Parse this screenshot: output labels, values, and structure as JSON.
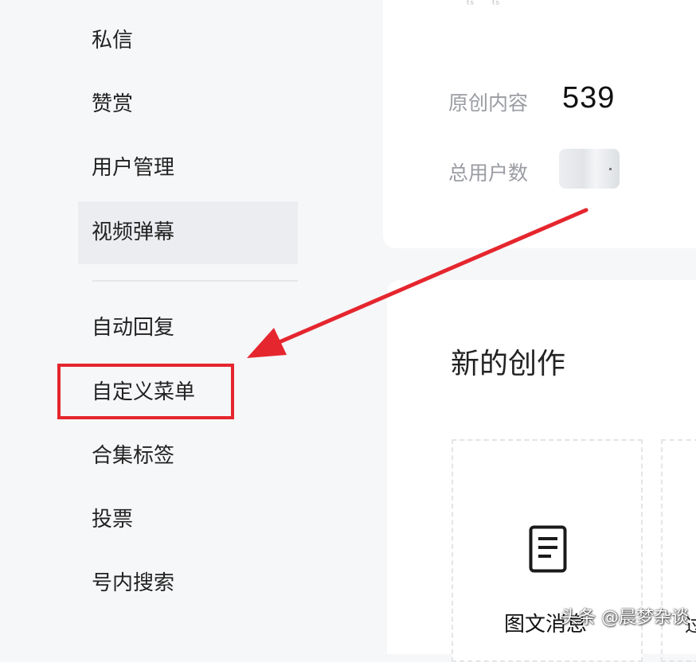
{
  "sidebar": {
    "items": [
      {
        "label": "私信"
      },
      {
        "label": "赞赏"
      },
      {
        "label": "用户管理"
      },
      {
        "label": "视频弹幕"
      },
      {
        "label": "自动回复"
      },
      {
        "label": "自定义菜单"
      },
      {
        "label": "合集标签"
      },
      {
        "label": "投票"
      },
      {
        "label": "号内搜索"
      }
    ]
  },
  "stats": {
    "original_label": "原创内容",
    "original_value": "539",
    "users_label": "总用户数"
  },
  "create": {
    "title": "新的创作",
    "tile_label": "图文消息",
    "tile_icon": "document-icon",
    "next_tile_glyph": "过"
  },
  "watermark": {
    "text": "头条 @晨梦杂谈"
  },
  "annotation": {
    "color": "#e5262e"
  }
}
